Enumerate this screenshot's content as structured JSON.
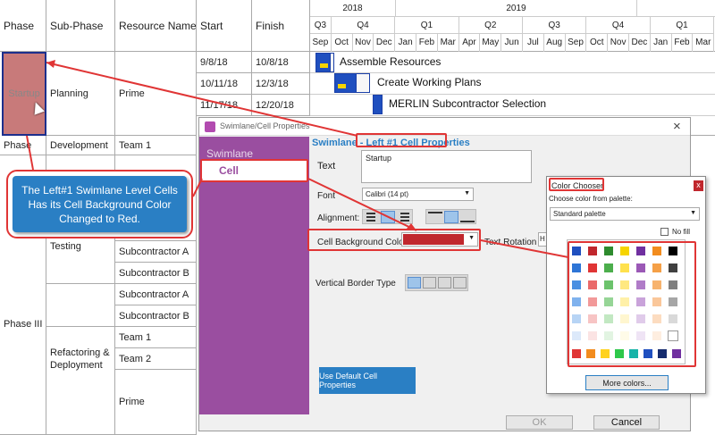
{
  "grid": {
    "headers": {
      "phase": "Phase",
      "subphase": "Sub-Phase",
      "resources": "Resource Names",
      "start": "Start",
      "finish": "Finish"
    },
    "rows": [
      {
        "start": "9/8/18",
        "finish": "10/8/18"
      },
      {
        "start": "10/11/18",
        "finish": "12/3/18"
      },
      {
        "start": "11/17/18",
        "finish": "12/20/18"
      }
    ],
    "phase_startup": "Startup",
    "planning": "Planning",
    "prime_1": "Prime",
    "phase_cut": "Phase",
    "development": "Development",
    "team1_top": "Team 1",
    "testing": "Testing",
    "sub_a1": "Subcontractor A",
    "sub_b1": "Subcontractor B",
    "sub_a2": "Subcontractor A",
    "sub_b2": "Subcontractor B",
    "phase3": "Phase III",
    "refactoring": "Refactoring & Deployment",
    "team1": "Team 1",
    "team2": "Team 2",
    "prime_2": "Prime"
  },
  "timeline": {
    "years": [
      "2018",
      "2019"
    ],
    "quarters": [
      "Q3",
      "Q4",
      "Q1",
      "Q2",
      "Q3",
      "Q4",
      "Q1"
    ],
    "months": [
      "Sep",
      "Oct",
      "Nov",
      "Dec",
      "Jan",
      "Feb",
      "Mar",
      "Apr",
      "May",
      "Jun",
      "Jul",
      "Aug",
      "Sep",
      "Oct",
      "Nov",
      "Dec",
      "Jan",
      "Feb",
      "Mar"
    ]
  },
  "tasks": [
    "Assemble Resources",
    "Create Working Plans",
    "MERLIN Subcontractor Selection"
  ],
  "callout_text": "The Left#1 Swimlane Level Cells Has its Cell Background Color Changed to Red.",
  "dialog": {
    "title": "Swimlane/Cell Properties",
    "close": "×",
    "nav_swimlane": "Swimlane",
    "nav_cell": "Cell",
    "heading_prefix": "Swimlane - ",
    "heading_highlight": "Left #1 Cell Properties",
    "text_label": "Text",
    "text_value": "Startup",
    "font_label": "Font",
    "font_value": "Calibri (14 pt)",
    "alignment_label": "Alignment:",
    "bg_color_label": "Cell Background Color",
    "bg_color_value": "#c0272d",
    "text_rotation_label": "Text Rotation",
    "text_rotation_value": "H",
    "vertical_border_label": "Vertical Border Type",
    "use_default_button": "Use Default Cell Properties",
    "ok": "OK",
    "cancel": "Cancel"
  },
  "chooser": {
    "title": "Color Chooser",
    "close": "x",
    "palette_prompt": "Choose color from palette:",
    "palette_value": "Standard palette",
    "no_fill": "No fill",
    "more_colors": "More colors...",
    "colors": [
      [
        "#1f4fbf",
        "#c0272d",
        "#2e8b2e",
        "#f6d400",
        "#7030a0",
        "#f28c1e",
        "#000000"
      ],
      [
        "#2e75d6",
        "#e03535",
        "#4cae4c",
        "#ffe14d",
        "#9b59b6",
        "#f5a047",
        "#404040"
      ],
      [
        "#4a90e2",
        "#ea6a6a",
        "#6cc36c",
        "#ffe880",
        "#b07cc8",
        "#f7b36e",
        "#7f7f7f"
      ],
      [
        "#7fb2ee",
        "#f29999",
        "#96d596",
        "#fff0a8",
        "#c9a3da",
        "#fac79a",
        "#a6a6a6"
      ],
      [
        "#b7d4f5",
        "#f7c4c4",
        "#c2e8c2",
        "#fff6cf",
        "#e0cbea",
        "#fcdcc0",
        "#d9d9d9"
      ],
      [
        "#dce9fa",
        "#fbe3e3",
        "#e2f4e2",
        "#fffbe8",
        "#efe4f5",
        "#feeee0",
        "#ffffff"
      ]
    ],
    "bright": [
      "#e03535",
      "#f28c1e",
      "#ffd21f",
      "#2ec84a",
      "#17b3a8",
      "#1f4fbf",
      "#162c6e",
      "#7030a0"
    ]
  }
}
